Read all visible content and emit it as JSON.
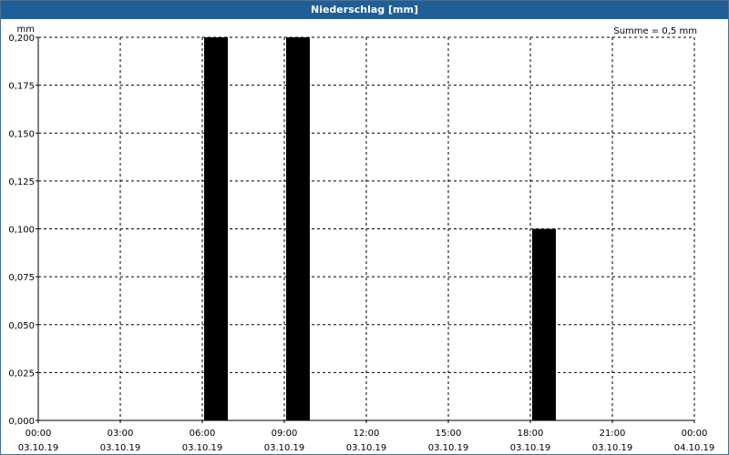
{
  "window": {
    "title": "Niederschlag [mm]"
  },
  "summary": "Summe = 0,5 mm",
  "chart_data": {
    "type": "bar",
    "title": "Niederschlag [mm]",
    "ylabel": "mm",
    "ylim": [
      0,
      0.2
    ],
    "grid": true,
    "y_ticks": [
      "0,000",
      "0,025",
      "0,050",
      "0,075",
      "0,100",
      "0,125",
      "0,150",
      "0,175",
      "0,200"
    ],
    "x_ticks": [
      {
        "time": "00:00",
        "date": "03.10.19"
      },
      {
        "time": "03:00",
        "date": "03.10.19"
      },
      {
        "time": "06:00",
        "date": "03.10.19"
      },
      {
        "time": "09:00",
        "date": "03.10.19"
      },
      {
        "time": "12:00",
        "date": "03.10.19"
      },
      {
        "time": "15:00",
        "date": "03.10.19"
      },
      {
        "time": "18:00",
        "date": "03.10.19"
      },
      {
        "time": "21:00",
        "date": "03.10.19"
      },
      {
        "time": "00:00",
        "date": "04.10.19"
      }
    ],
    "bars": [
      {
        "x": "06:00–07:00",
        "value": 0.2
      },
      {
        "x": "09:00–10:00",
        "value": 0.2
      },
      {
        "x": "18:00–19:00",
        "value": 0.1
      }
    ],
    "bar_color": "#000000"
  }
}
